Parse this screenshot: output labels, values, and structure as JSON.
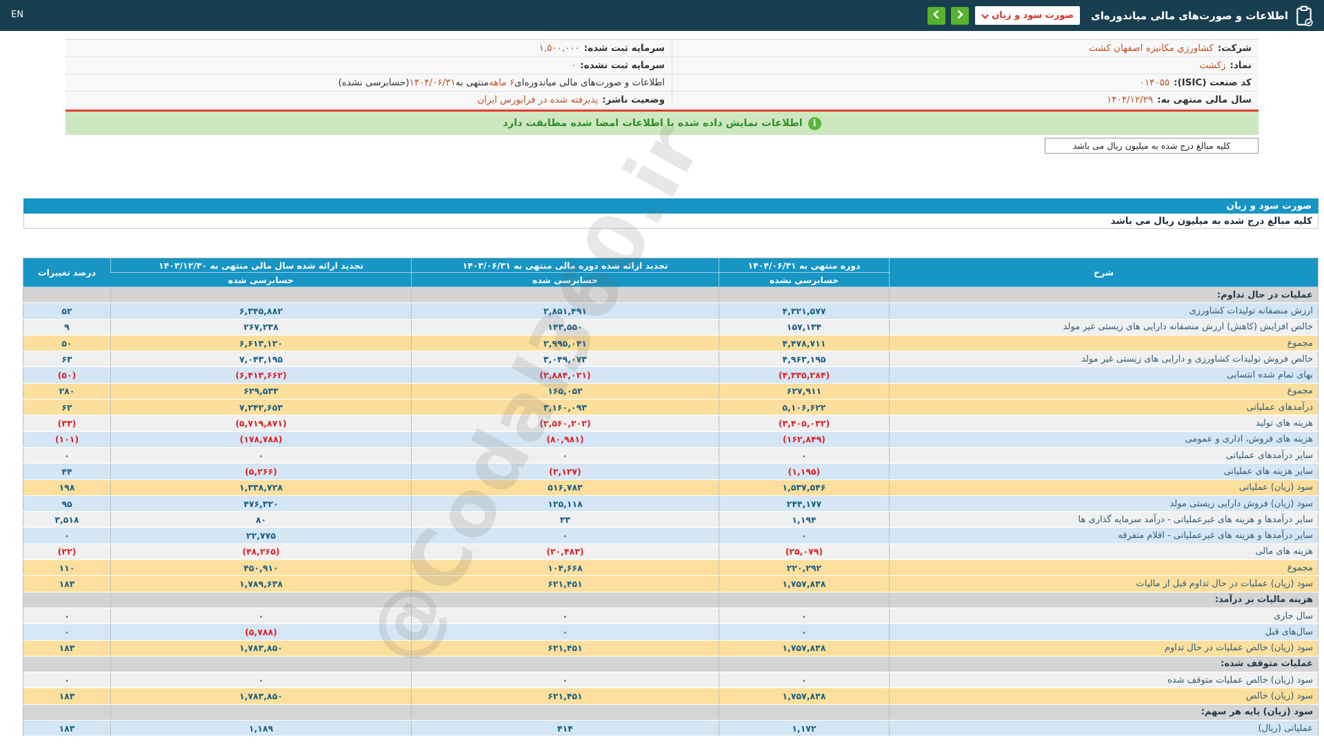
{
  "topbar": {
    "en": "EN",
    "title": "اطلاعات و صورت‌های مالی میاندوره‌ای",
    "statement_select": "صورت سود و زیان"
  },
  "company_info": {
    "rows": [
      {
        "r_label": "شرکت:",
        "r_value": "کشاورزي مکانیزه اصفهان کشت",
        "l_label": "سرمایه ثبت شده:",
        "l_value": "۱,۵۰۰,۰۰۰"
      },
      {
        "r_label": "نماد:",
        "r_value": "زکشت",
        "l_label": "سرمایه ثبت نشده:",
        "l_value": "۰"
      },
      {
        "r_label": "کد صنعت (ISIC):",
        "r_value": "۰۱۴۰۵۵",
        "l_seg1": "اطلاعات و صورت‌های مالی میاندوره‌ای ",
        "l_seg2": "۶ ماهه",
        "l_seg3": " منتهی به ",
        "l_seg4": "۱۴۰۴/۰۶/۳۱",
        "l_seg5": "(حسابرسی نشده)"
      },
      {
        "r_label": "سال مالی منتهی به:",
        "r_value": "۱۴۰۴/۱۲/۲۹",
        "l_label": "وضعیت ناشر:",
        "l_value": "پذیرفته شده در فرابورس ایران"
      }
    ]
  },
  "banner": {
    "text": "اطلاعات نمایش داده شده با اطلاعات امضا شده مطابقت دارد",
    "icon": "i"
  },
  "units_note": "کلیه مبالغ درج شده به میلیون ریال می باشد",
  "section_bar": "صورت سود و زیان",
  "watermark": "@Codal360.ir",
  "colors": {
    "topbar_bg": "#183f50",
    "accent_blue": "#1795c4",
    "green_button": "#55b32e",
    "banner_bg": "#cde8c0",
    "banner_text": "#2f8f2a",
    "value_orange": "#bd5327",
    "negative_red": "#e01f26",
    "number_blue": "#1a5f82",
    "row_blue": "#d4e6f4",
    "row_yellow": "#fcdf9c",
    "row_section": "#d4d4d4",
    "red_line": "#e23b2e"
  },
  "table": {
    "headers": {
      "desc": "شرح",
      "p1": "دوره منتهی به ۱۴۰۴/۰۶/۳۱",
      "p1_sub": "حسابرسی نشده",
      "p2": "تجدید ارائه شده دوره مالی منتهی به ۱۴۰۳/۰۶/۳۱",
      "p2_sub": "حسابرسی شده",
      "p3": "تجدید ارائه شده سال مالی منتهی به ۱۴۰۳/۱۲/۳۰",
      "p3_sub": "حسابرسی شده",
      "pct": "درصد تغییرات"
    },
    "rows": [
      {
        "desc": "عملیات در حال تداوم:",
        "v1": "",
        "v2": "",
        "v3": "",
        "pct": "",
        "bg": "section"
      },
      {
        "desc": "ارزش منصفانه تولیدات کشاورزی",
        "v1": "۴,۳۲۱,۵۷۷",
        "v2": "۲,۸۵۱,۴۹۱",
        "v3": "۶,۳۴۵,۸۸۲",
        "pct": "۵۲",
        "bg": "blue"
      },
      {
        "desc": "خالص افزایش (کاهش) ارزش منصفانه دارایی های زیستی غیر مولد",
        "v1": "۱۵۷,۱۳۴",
        "v2": "۱۴۳,۵۵۰",
        "v3": "۲۶۷,۲۳۸",
        "pct": "۹",
        "bg": "light"
      },
      {
        "desc": "مجموع",
        "v1": "۴,۴۷۸,۷۱۱",
        "v2": "۲,۹۹۵,۰۴۱",
        "v3": "۶,۶۱۳,۱۲۰",
        "pct": "۵۰",
        "bg": "yellow"
      },
      {
        "desc": "خالص فروش تولیدات کشاورزی و دارایی های زیستی غیر مولد",
        "v1": "۴,۹۶۳,۱۹۵",
        "v2": "۳,۰۴۹,۰۷۳",
        "v3": "۷,۰۴۳,۱۹۵",
        "pct": "۶۳",
        "bg": "light"
      },
      {
        "desc": "بهای تمام شده انتسابی",
        "v1": "(۴,۳۳۵,۲۸۴)",
        "v2": "(۲,۸۸۴,۰۲۱)",
        "v3": "(۶,۴۱۳,۶۶۲)",
        "pct": "(۵۰)",
        "bg": "blue"
      },
      {
        "desc": "مجموع",
        "v1": "۶۲۷,۹۱۱",
        "v2": "۱۶۵,۰۵۲",
        "v3": "۶۲۹,۵۳۳",
        "pct": "۲۸۰",
        "bg": "yellow"
      },
      {
        "desc": "درآمدهای عملیاتی",
        "v1": "۵,۱۰۶,۶۲۲",
        "v2": "۳,۱۶۰,۰۹۳",
        "v3": "۷,۲۴۲,۶۵۳",
        "pct": "۶۲",
        "bg": "yellow"
      },
      {
        "desc": "هزینه های تولید",
        "v1": "(۳,۴۰۵,۰۳۲)",
        "v2": "(۲,۵۶۰,۲۰۲)",
        "v3": "(۵,۷۱۹,۸۷۱)",
        "pct": "(۳۳)",
        "bg": "light"
      },
      {
        "desc": "هزینه های فروش، اداری و عمومی",
        "v1": "(۱۶۲,۸۴۹)",
        "v2": "(۸۰,۹۸۱)",
        "v3": "(۱۷۸,۷۸۸)",
        "pct": "(۱۰۱)",
        "bg": "blue"
      },
      {
        "desc": "سایر درآمدهای عملیاتی",
        "v1": "۰",
        "v2": "۰",
        "v3": "۰",
        "pct": "۰",
        "bg": "light"
      },
      {
        "desc": "سایر هزینه های عملیاتی",
        "v1": "(۱,۱۹۵)",
        "v2": "(۲,۱۲۷)",
        "v3": "(۵,۲۶۶)",
        "pct": "۴۴",
        "bg": "blue"
      },
      {
        "desc": "سود (زیان) عملیاتی",
        "v1": "۱,۵۳۷,۵۴۶",
        "v2": "۵۱۶,۷۸۳",
        "v3": "۱,۳۳۸,۷۲۸",
        "pct": "۱۹۸",
        "bg": "yellow"
      },
      {
        "desc": "سود (زیان) فروش دارایی زیستی مولد",
        "v1": "۲۴۴,۱۷۷",
        "v2": "۱۲۵,۱۱۸",
        "v3": "۴۷۶,۳۲۰",
        "pct": "۹۵",
        "bg": "blue"
      },
      {
        "desc": "سایر درآمدها و هزینه های غیرعملیاتی - درآمد سرمایه گذاری ها",
        "v1": "۱,۱۹۴",
        "v2": "۳۳",
        "v3": "۸۰",
        "pct": "۳,۵۱۸",
        "bg": "light"
      },
      {
        "desc": "سایر درآمدها و هزینه های غیرعملیاتی - اقلام متفرقه",
        "v1": "۰",
        "v2": "۰",
        "v3": "۲۲,۷۷۵",
        "pct": "۰",
        "bg": "blue"
      },
      {
        "desc": "هزینه های مالی",
        "v1": "(۲۵,۰۷۹)",
        "v2": "(۲۰,۴۸۳)",
        "v3": "(۴۸,۲۶۵)",
        "pct": "(۲۲)",
        "bg": "light"
      },
      {
        "desc": "مجموع",
        "v1": "۲۲۰,۲۹۲",
        "v2": "۱۰۴,۶۶۸",
        "v3": "۴۵۰,۹۱۰",
        "pct": "۱۱۰",
        "bg": "yellow"
      },
      {
        "desc": "سود (زیان) عملیات در حال تداوم قبل از مالیات",
        "v1": "۱,۷۵۷,۸۳۸",
        "v2": "۶۲۱,۴۵۱",
        "v3": "۱,۷۸۹,۶۳۸",
        "pct": "۱۸۳",
        "bg": "yellow"
      },
      {
        "desc": "هزینه مالیات بر درآمد:",
        "v1": "",
        "v2": "",
        "v3": "",
        "pct": "",
        "bg": "section"
      },
      {
        "desc": "سال جاری",
        "v1": "۰",
        "v2": "۰",
        "v3": "۰",
        "pct": "۰",
        "bg": "light"
      },
      {
        "desc": "سال‌های قبل",
        "v1": "۰",
        "v2": "۰",
        "v3": "(۵,۷۸۸)",
        "pct": "۰",
        "bg": "blue"
      },
      {
        "desc": "سود (زیان) خالص عملیات در حال تداوم",
        "v1": "۱,۷۵۷,۸۳۸",
        "v2": "۶۲۱,۴۵۱",
        "v3": "۱,۷۸۳,۸۵۰",
        "pct": "۱۸۳",
        "bg": "yellow"
      },
      {
        "desc": "عملیات متوقف شده:",
        "v1": "",
        "v2": "",
        "v3": "",
        "pct": "",
        "bg": "section"
      },
      {
        "desc": "سود (زیان) خالص عملیات متوقف شده",
        "v1": "۰",
        "v2": "۰",
        "v3": "۰",
        "pct": "۰",
        "bg": "light"
      },
      {
        "desc": "سود (زیان) خالص",
        "v1": "۱,۷۵۷,۸۳۸",
        "v2": "۶۲۱,۴۵۱",
        "v3": "۱,۷۸۳,۸۵۰",
        "pct": "۱۸۳",
        "bg": "yellow"
      },
      {
        "desc": "سود (زیان) پایه هر سهم:",
        "v1": "",
        "v2": "",
        "v3": "",
        "pct": "",
        "bg": "section"
      },
      {
        "desc": "عملیاتی (ریال)",
        "v1": "۱,۱۷۲",
        "v2": "۴۱۴",
        "v3": "۱,۱۸۹",
        "pct": "۱۸۳",
        "bg": "blue"
      }
    ]
  }
}
